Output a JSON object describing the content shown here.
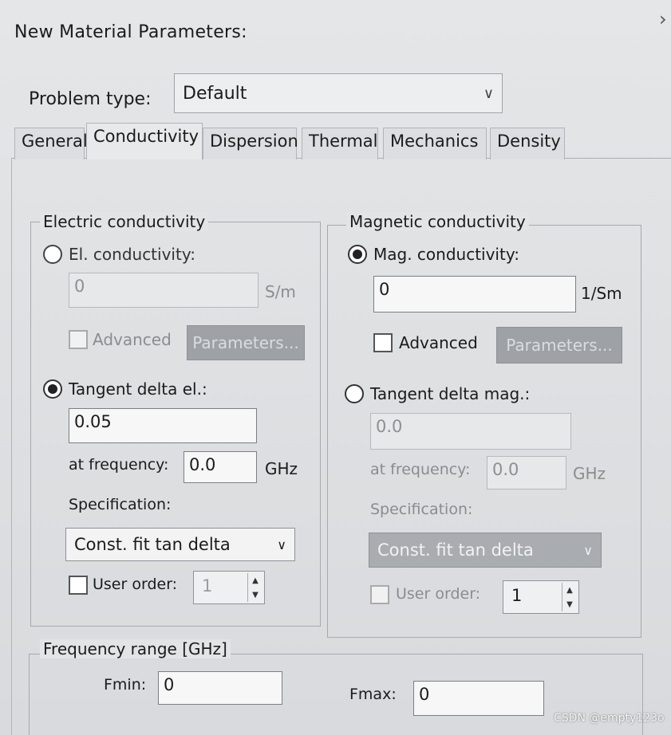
{
  "window": {
    "title": "New Material Parameters:"
  },
  "problem_type": {
    "label": "Problem type:",
    "value": "Default"
  },
  "tabs": [
    {
      "label": "General"
    },
    {
      "label": "Conductivity"
    },
    {
      "label": "Dispersion"
    },
    {
      "label": "Thermal"
    },
    {
      "label": "Mechanics"
    },
    {
      "label": "Density"
    }
  ],
  "electric": {
    "group_title": "Electric conductivity",
    "radio_conductivity": "El. conductivity:",
    "conductivity_value": "0",
    "conductivity_unit": "S/m",
    "advanced_label": "Advanced",
    "parameters_label": "Parameters...",
    "radio_tangent": "Tangent delta el.:",
    "tangent_value": "0.05",
    "at_frequency_label": "at frequency:",
    "frequency_value": "0.0",
    "frequency_unit": "GHz",
    "specification_label": "Specification:",
    "specification_value": "Const. fit tan delta",
    "user_order_label": "User order:",
    "user_order_value": "1"
  },
  "magnetic": {
    "group_title": "Magnetic conductivity",
    "radio_conductivity": "Mag. conductivity:",
    "conductivity_value": "0",
    "conductivity_unit": "1/Sm",
    "advanced_label": "Advanced",
    "parameters_label": "Parameters...",
    "radio_tangent": "Tangent delta mag.:",
    "tangent_value": "0.0",
    "at_frequency_label": "at frequency:",
    "frequency_value": "0.0",
    "frequency_unit": "GHz",
    "specification_label": "Specification:",
    "specification_value": "Const. fit tan delta",
    "user_order_label": "User order:",
    "user_order_value": "1"
  },
  "frequency_range": {
    "group_title": "Frequency range [GHz]",
    "fmin_label": "Fmin:",
    "fmin_value": "0",
    "fmax_label": "Fmax:",
    "fmax_value": "0"
  },
  "watermark": "CSDN @empty123o"
}
